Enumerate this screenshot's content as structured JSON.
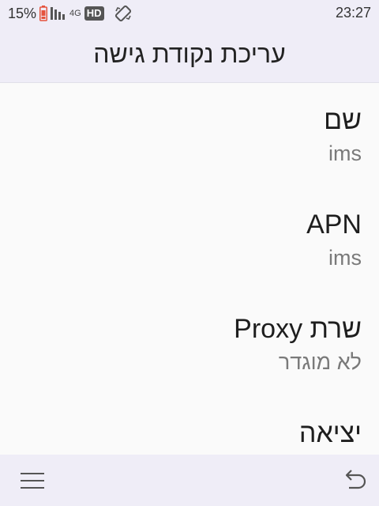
{
  "status_bar": {
    "battery_percent": "15%",
    "network_type": "4G",
    "hd_label": "HD",
    "time": "23:27"
  },
  "header": {
    "title": "עריכת נקודת גישה"
  },
  "preferences": [
    {
      "title": "שם",
      "summary": "ims"
    },
    {
      "title": "APN",
      "summary": "ims"
    },
    {
      "title": "שרת Proxy",
      "summary": "לא מוגדר"
    },
    {
      "title": "יציאה",
      "summary": ""
    }
  ],
  "icons": {
    "menu": "hamburger-menu-icon",
    "back": "back-arrow-icon",
    "battery": "battery-low-icon",
    "signal": "signal-bars-icon",
    "rotate": "auto-rotate-icon"
  },
  "colors": {
    "bar_background": "#efedf7",
    "content_background": "#fafafa",
    "battery_warning": "#e5533d"
  }
}
